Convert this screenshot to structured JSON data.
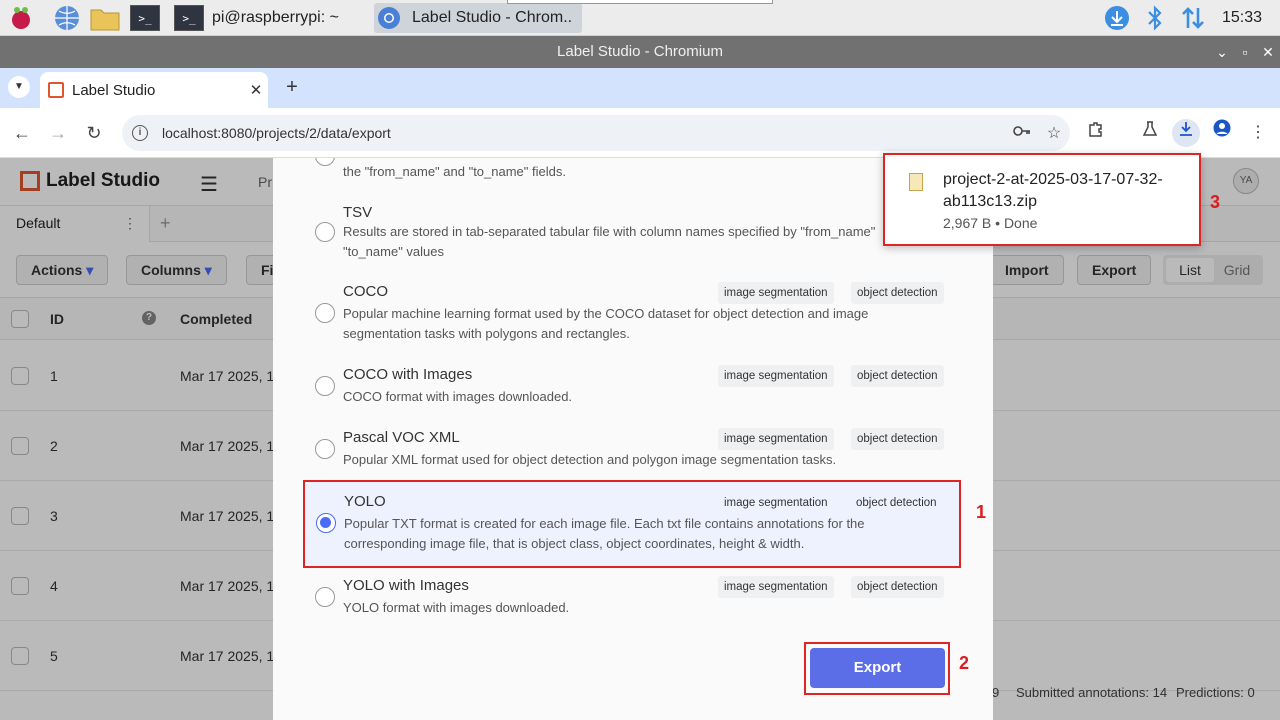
{
  "taskbar": {
    "terminal_label": "pi@raspberrypi: ~",
    "chromium_label": "Label Studio - Chrom..",
    "clock": "15:33"
  },
  "window": {
    "title": "Label Studio - Chromium"
  },
  "browser": {
    "tab_title": "Label Studio",
    "url": "localhost:8080/projects/2/data/export"
  },
  "app": {
    "logo_text": "Label Studio",
    "breadcrumb": "Pr",
    "avatar_initials": "YA",
    "view_tab": "Default",
    "buttons": {
      "actions": "Actions",
      "columns": "Columns",
      "filters": "Fil",
      "import": "Import",
      "export": "Export",
      "list": "List",
      "grid": "Grid"
    },
    "table": {
      "headers": {
        "id": "ID",
        "completed": "Completed"
      },
      "rows": [
        {
          "id": "1",
          "completed": "Mar 17 2025, 1"
        },
        {
          "id": "2",
          "completed": "Mar 17 2025, 1"
        },
        {
          "id": "3",
          "completed": "Mar 17 2025, 1"
        },
        {
          "id": "4",
          "completed": "Mar 17 2025, 1"
        },
        {
          "id": "5",
          "completed": "Mar 17 2025, 1"
        }
      ]
    },
    "footer": {
      "partial": "9",
      "submitted": "Submitted annotations: 14",
      "predictions": "Predictions: 0"
    }
  },
  "export_modal": {
    "top_partial_desc": "the \"from_name\" and \"to_name\" fields.",
    "formats": [
      {
        "title": "TSV",
        "desc": "Results are stored in tab-separated tabular file with column names specified by \"from_name\" \"to_name\" values",
        "tags": []
      },
      {
        "title": "COCO",
        "desc": "Popular machine learning format used by the COCO dataset for object detection and image segmentation tasks with polygons and rectangles.",
        "tags": [
          "image segmentation",
          "object detection"
        ]
      },
      {
        "title": "COCO with Images",
        "desc": "COCO format with images downloaded.",
        "tags": [
          "image segmentation",
          "object detection"
        ]
      },
      {
        "title": "Pascal VOC XML",
        "desc": "Popular XML format used for object detection and polygon image segmentation tasks.",
        "tags": [
          "image segmentation",
          "object detection"
        ]
      },
      {
        "title": "YOLO",
        "desc": "Popular TXT format is created for each image file. Each txt file contains annotations for the corresponding image file, that is object class, object coordinates, height & width.",
        "tags": [
          "image segmentation",
          "object detection"
        ],
        "selected": true
      },
      {
        "title": "YOLO with Images",
        "desc": "YOLO format with images downloaded.",
        "tags": [
          "image segmentation",
          "object detection"
        ]
      }
    ],
    "export_button": "Export"
  },
  "download": {
    "filename": "project-2-at-2025-03-17-07-32-ab113c13.zip",
    "status": "2,967 B • Done"
  },
  "markers": {
    "m1": "1",
    "m2": "2",
    "m3": "3"
  },
  "colors": {
    "accent": "#5b6ee8",
    "highlight": "#e02424",
    "brand": "#e0562d"
  }
}
